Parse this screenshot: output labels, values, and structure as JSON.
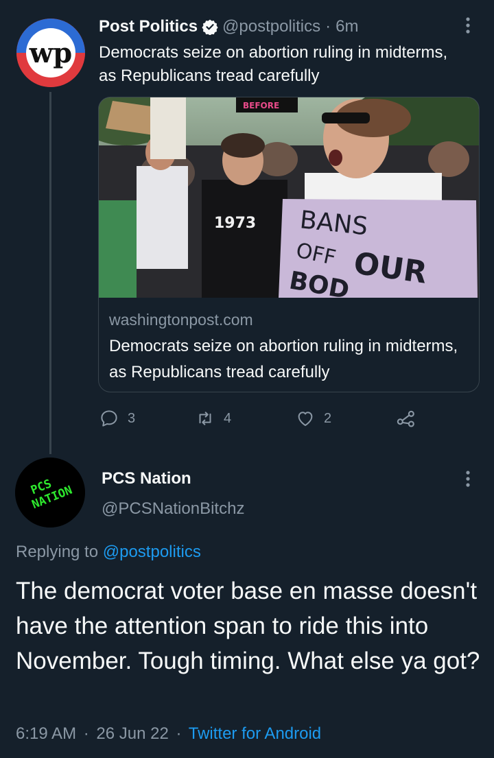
{
  "tweet": {
    "author_name": "Post Politics",
    "handle": "@postpolitics",
    "separator": "·",
    "time": "6m",
    "text": "Democrats seize on abortion ruling in midterms, as Republicans tread carefully",
    "avatar_icon": "wp-logo-icon",
    "verified_icon": "verified-badge-icon",
    "card": {
      "domain": "washingtonpost.com",
      "title": "Democrats seize on abortion ruling in midterms, as Republicans tread carefully",
      "photo_sign_text": [
        "BANS",
        "OFF",
        "OUR",
        "BOD"
      ],
      "photo_small_sign": "BEFORE",
      "photo_shirt_text": "1973"
    },
    "stats": {
      "replies": "3",
      "retweets": "4",
      "likes": "2"
    }
  },
  "reply": {
    "author_name": "PCS Nation",
    "handle": "@PCSNationBitchz",
    "avatar_text": [
      "PCS",
      "NATION"
    ],
    "replying_label": "Replying to",
    "replying_to": "@postpolitics",
    "text": "The democrat voter base en masse doesn't have the attention span to ride this into November. Tough timing. What else ya got?",
    "time": "6:19 AM",
    "date": "26 Jun 22",
    "separator": "·",
    "client": "Twitter for Android"
  },
  "colors": {
    "background": "#15202b",
    "text": "#f7f9f9",
    "muted": "#8b98a5",
    "link": "#1d9bf0",
    "divider": "#38444d",
    "pcs_green": "#2ee82e"
  }
}
